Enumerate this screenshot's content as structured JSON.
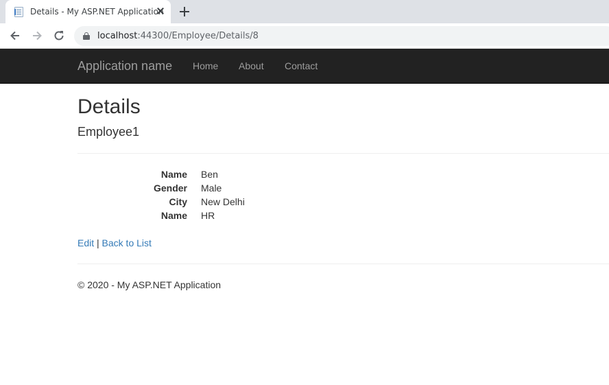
{
  "browser": {
    "tab_title": "Details - My ASP.NET Application",
    "url_host": "localhost",
    "url_path": ":44300/Employee/Details/8"
  },
  "navbar": {
    "brand": "Application name",
    "links": [
      "Home",
      "About",
      "Contact"
    ]
  },
  "page": {
    "title": "Details",
    "subtitle": "Employee1",
    "fields": [
      {
        "label": "Name",
        "value": "Ben"
      },
      {
        "label": "Gender",
        "value": "Male"
      },
      {
        "label": "City",
        "value": "New Delhi"
      },
      {
        "label": "Name",
        "value": "HR"
      }
    ],
    "actions": {
      "edit": "Edit",
      "separator": "|",
      "back": "Back to List"
    },
    "footer": "© 2020 - My ASP.NET Application"
  },
  "colors": {
    "navbar_bg": "#222222",
    "nav_link": "#9d9d9d",
    "link": "#337ab7",
    "text": "#333333"
  },
  "icons": [
    "page-favicon-icon",
    "close-icon",
    "plus-icon",
    "back-arrow-icon",
    "forward-arrow-icon",
    "reload-icon",
    "lock-icon"
  ]
}
